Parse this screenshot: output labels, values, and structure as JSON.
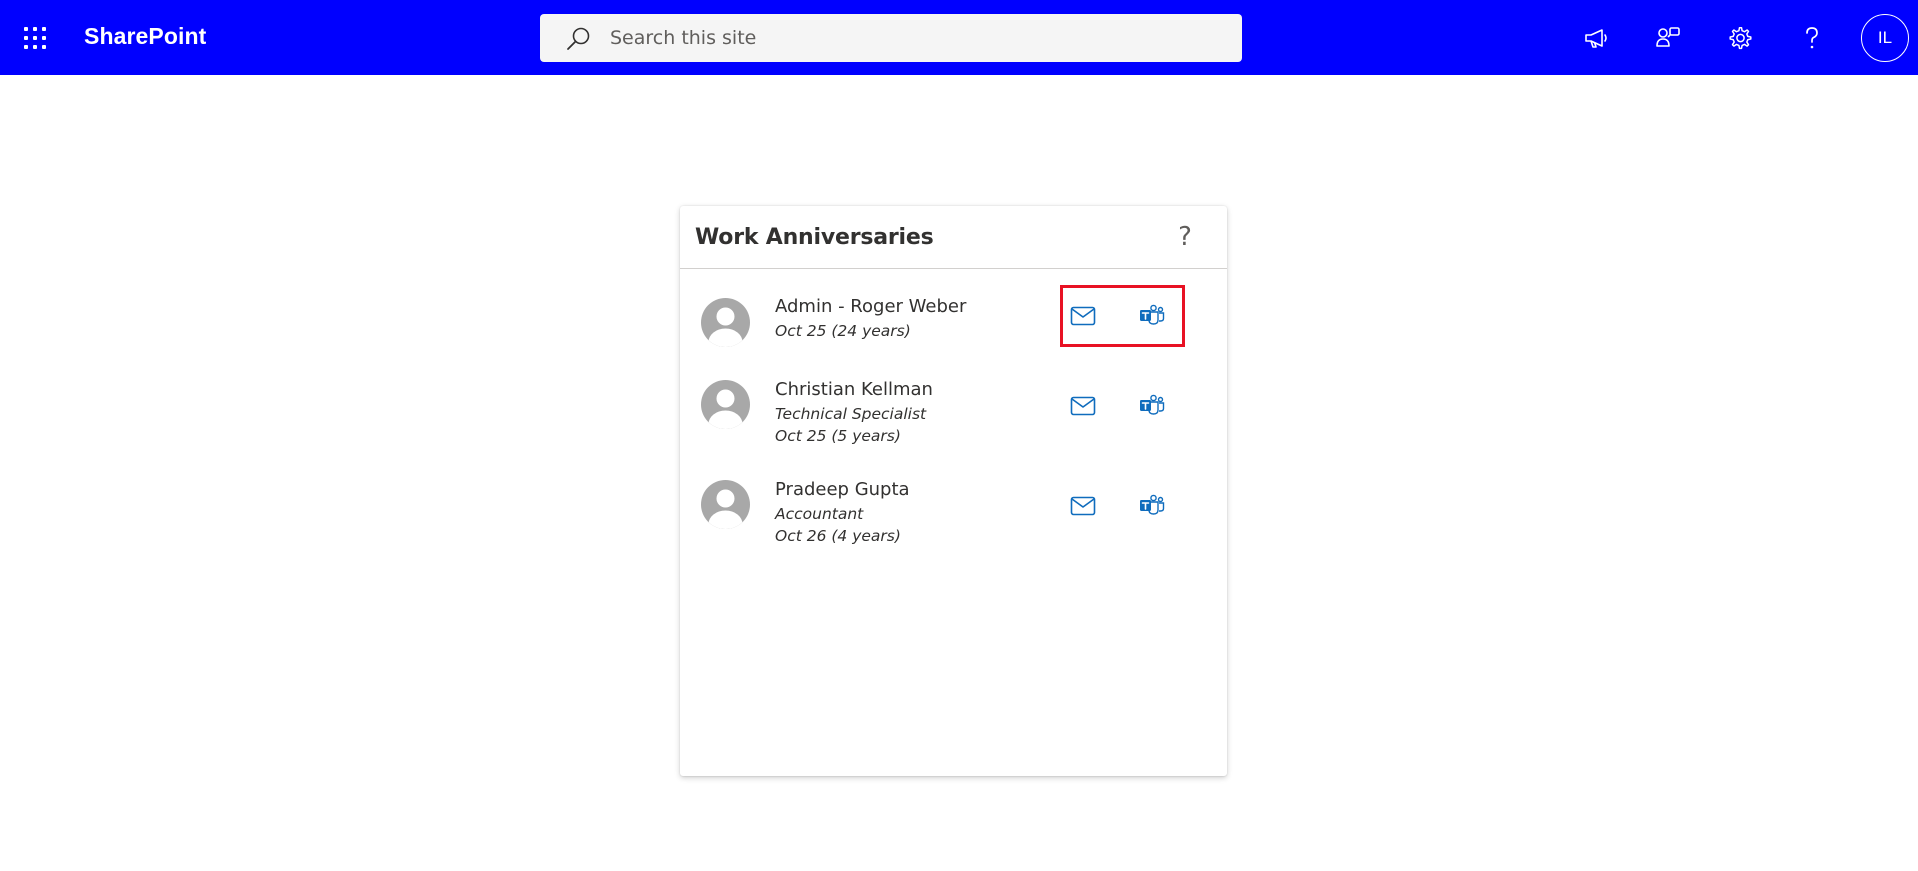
{
  "suite_bar": {
    "brand": "SharePoint",
    "search_placeholder": "Search this site",
    "avatar_initials": "IL"
  },
  "webpart": {
    "title": "Work Anniversaries",
    "help_label": "?",
    "people": [
      {
        "name": "Admin - Roger Weber",
        "job_title": "",
        "anniversary": "Oct 25 (24 years)"
      },
      {
        "name": "Christian Kellman",
        "job_title": "Technical Specialist",
        "anniversary": "Oct 25 (5 years)"
      },
      {
        "name": "Pradeep Gupta",
        "job_title": "Accountant",
        "anniversary": "Oct 26 (4 years)"
      }
    ]
  },
  "colors": {
    "suite_bar": "#0000ff",
    "icon_blue": "#0f6cbd",
    "highlight": "#e81123",
    "avatar_gray": "#a8a8a8"
  },
  "icons": {
    "app_launcher": "waffle-icon",
    "search": "search-icon",
    "announcements": "megaphone-icon",
    "connections": "people-connection-icon",
    "settings": "gear-icon",
    "help": "question-icon",
    "email": "mail-icon",
    "teams_chat": "teams-icon"
  }
}
